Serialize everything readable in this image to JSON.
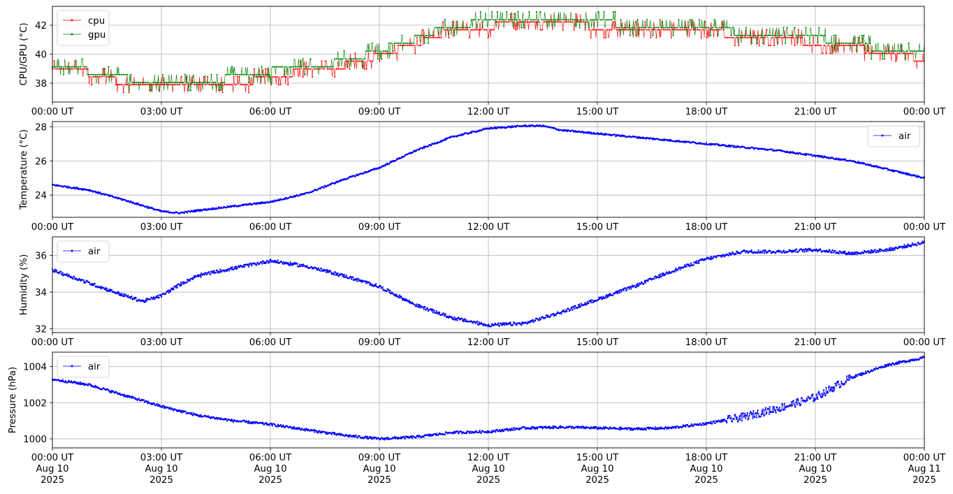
{
  "chart_data": [
    {
      "type": "line",
      "ylabel": "CPU/GPU (°C)",
      "xlim_hours": [
        0,
        24
      ],
      "ylim": [
        36.7,
        43.3
      ],
      "yticks": [
        38,
        40,
        42
      ],
      "xtick_labels": [
        "00:00 UT",
        "03:00 UT",
        "06:00 UT",
        "09:00 UT",
        "12:00 UT",
        "15:00 UT",
        "18:00 UT",
        "21:00 UT",
        "00:00 UT"
      ],
      "grid": true,
      "legend_position": "upper-left",
      "series": [
        {
          "name": "cpu",
          "color": "#ff0000",
          "x": [
            0,
            1,
            2,
            3,
            4,
            5,
            6,
            7,
            8,
            9,
            10,
            11,
            12,
            13,
            14,
            15,
            16,
            17,
            18,
            19,
            20,
            21,
            22,
            23,
            24
          ],
          "y": [
            39.0,
            38.6,
            37.9,
            37.6,
            37.6,
            37.8,
            38.3,
            38.8,
            39.1,
            39.8,
            40.6,
            41.6,
            41.8,
            42.1,
            42.0,
            41.8,
            41.7,
            41.6,
            41.5,
            41.1,
            40.9,
            40.7,
            40.4,
            39.9,
            39.6
          ]
        },
        {
          "name": "gpu",
          "color": "#008000",
          "x": [
            0,
            1,
            2,
            3,
            4,
            5,
            6,
            7,
            8,
            9,
            10,
            11,
            12,
            13,
            14,
            15,
            16,
            17,
            18,
            19,
            20,
            21,
            22,
            23,
            24
          ],
          "y": [
            38.8,
            38.6,
            38.1,
            37.6,
            37.7,
            38.2,
            38.6,
            39.0,
            39.2,
            40.0,
            40.8,
            41.8,
            41.9,
            42.3,
            42.2,
            41.9,
            41.8,
            41.7,
            41.7,
            41.2,
            41.0,
            40.8,
            40.7,
            39.8,
            39.7
          ]
        }
      ]
    },
    {
      "type": "line",
      "ylabel": "Temperature (°C)",
      "xlim_hours": [
        0,
        24
      ],
      "ylim": [
        22.7,
        28.3
      ],
      "yticks": [
        24,
        26,
        28
      ],
      "xtick_labels": [
        "00:00 UT",
        "03:00 UT",
        "06:00 UT",
        "09:00 UT",
        "12:00 UT",
        "15:00 UT",
        "18:00 UT",
        "21:00 UT",
        "00:00 UT"
      ],
      "grid": true,
      "legend_position": "upper-right",
      "series": [
        {
          "name": "air",
          "color": "#0000ff",
          "x": [
            0,
            1,
            2,
            3,
            3.5,
            4,
            5,
            6,
            7,
            8,
            9,
            10,
            11,
            12,
            13,
            13.5,
            14,
            15,
            16,
            17,
            18,
            19,
            20,
            21,
            22,
            23,
            24
          ],
          "y": [
            24.6,
            24.3,
            23.7,
            23.05,
            22.95,
            23.1,
            23.35,
            23.6,
            24.1,
            24.9,
            25.6,
            26.6,
            27.4,
            27.9,
            28.05,
            28.05,
            27.8,
            27.6,
            27.4,
            27.2,
            27.0,
            26.8,
            26.6,
            26.3,
            26.0,
            25.5,
            25.0
          ]
        }
      ]
    },
    {
      "type": "line",
      "ylabel": "Humidity (%)",
      "xlim_hours": [
        0,
        24
      ],
      "ylim": [
        31.8,
        37.0
      ],
      "yticks": [
        32,
        34,
        36
      ],
      "xtick_labels": [
        "00:00 UT",
        "03:00 UT",
        "06:00 UT",
        "09:00 UT",
        "12:00 UT",
        "15:00 UT",
        "18:00 UT",
        "21:00 UT",
        "00:00 UT"
      ],
      "grid": true,
      "legend_position": "upper-left",
      "series": [
        {
          "name": "air",
          "color": "#0000ff",
          "x": [
            0,
            1,
            2,
            2.5,
            3,
            3.5,
            4,
            5,
            6,
            7,
            8,
            9,
            10,
            11,
            12,
            13,
            14,
            15,
            16,
            17,
            18,
            19,
            20,
            21,
            22,
            23,
            24
          ],
          "y": [
            35.2,
            34.5,
            33.8,
            33.5,
            33.8,
            34.4,
            34.9,
            35.3,
            35.7,
            35.4,
            34.9,
            34.3,
            33.3,
            32.6,
            32.2,
            32.3,
            32.9,
            33.6,
            34.3,
            35.1,
            35.8,
            36.2,
            36.2,
            36.3,
            36.1,
            36.3,
            36.7
          ]
        }
      ]
    },
    {
      "type": "line",
      "ylabel": "Pressure (hPa)",
      "xlim_hours": [
        0,
        24
      ],
      "ylim": [
        999.5,
        1004.8
      ],
      "yticks": [
        1000,
        1002,
        1004
      ],
      "xtick_labels": [
        "00:00 UT\nAug 10\n2025",
        "03:00 UT\nAug 10\n2025",
        "06:00 UT\nAug 10\n2025",
        "09:00 UT\nAug 10\n2025",
        "12:00 UT\nAug 10\n2025",
        "15:00 UT\nAug 10\n2025",
        "18:00 UT\nAug 10\n2025",
        "21:00 UT\nAug 10\n2025",
        "00:00 UT\nAug 11\n2025"
      ],
      "grid": true,
      "legend_position": "upper-left",
      "series": [
        {
          "name": "air",
          "color": "#0000ff",
          "x": [
            0,
            1,
            2,
            3,
            4,
            5,
            6,
            7,
            8,
            9,
            10,
            11,
            12,
            13,
            14,
            15,
            16,
            17,
            18,
            19,
            20,
            21,
            22,
            23,
            24
          ],
          "y": [
            1003.3,
            1003.0,
            1002.4,
            1001.8,
            1001.3,
            1001.0,
            1000.8,
            1000.5,
            1000.2,
            1000.0,
            1000.1,
            1000.35,
            1000.4,
            1000.6,
            1000.65,
            1000.6,
            1000.55,
            1000.6,
            1000.85,
            1001.2,
            1001.7,
            1002.3,
            1003.4,
            1004.1,
            1004.5
          ]
        }
      ]
    }
  ]
}
